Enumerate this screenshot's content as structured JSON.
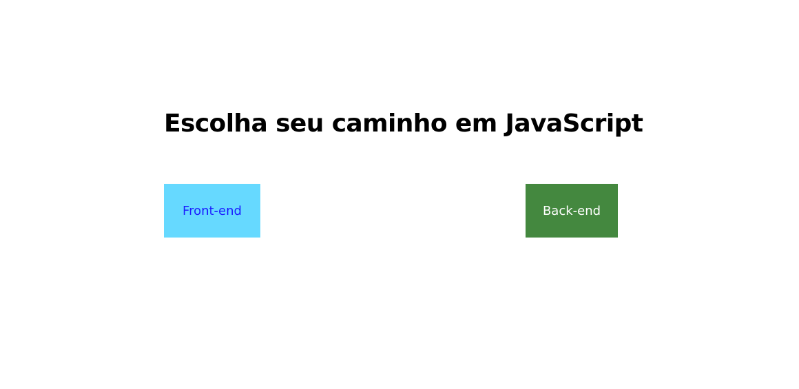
{
  "page": {
    "title": "Escolha seu caminho em JavaScript"
  },
  "buttons": {
    "frontend_label": "Front-end",
    "backend_label": "Back-end"
  },
  "colors": {
    "frontend_bg": "#66d9ff",
    "frontend_text": "#1a1aff",
    "backend_bg": "#44883f",
    "backend_text": "#ffffff"
  }
}
